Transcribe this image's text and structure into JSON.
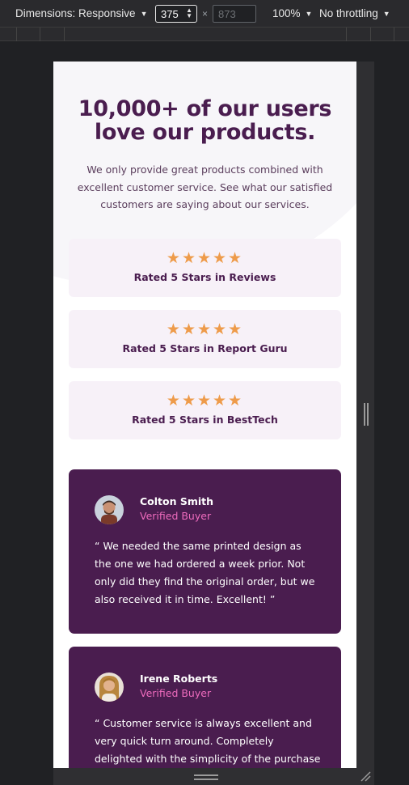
{
  "toolbar": {
    "dimensions_label": "Dimensions: Responsive",
    "width_value": "375",
    "height_placeholder": "873",
    "times": "×",
    "zoom": "100%",
    "throttling": "No throttling"
  },
  "page": {
    "headline_line1": "10,000+ of our users",
    "headline_line2": "love our products.",
    "intro": "We only provide great products combined with excellent customer service. See what our satisfied customers are saying about our services.",
    "ratings": [
      {
        "stars": "★★★★★",
        "label": "Rated 5 Stars in Reviews"
      },
      {
        "stars": "★★★★★",
        "label": "Rated 5 Stars in Report Guru"
      },
      {
        "stars": "★★★★★",
        "label": "Rated 5 Stars in BestTech"
      }
    ],
    "testimonials": [
      {
        "name": "Colton Smith",
        "status": "Verified Buyer",
        "quote": "“ We needed the same printed design as the one we had ordered a week prior. Not only did they find the original order, but we also received it in time. Excellent! ”"
      },
      {
        "name": "Irene Roberts",
        "status": "Verified Buyer",
        "quote": "“ Customer service is always excellent and very quick turn around. Completely delighted with the simplicity of the purchase and the"
      }
    ]
  },
  "colors": {
    "brand_purple": "#4a1d4f",
    "star_orange": "#ee9b4a",
    "verified_pink": "#ee6bbd",
    "card_bg": "#f7f1f8"
  }
}
